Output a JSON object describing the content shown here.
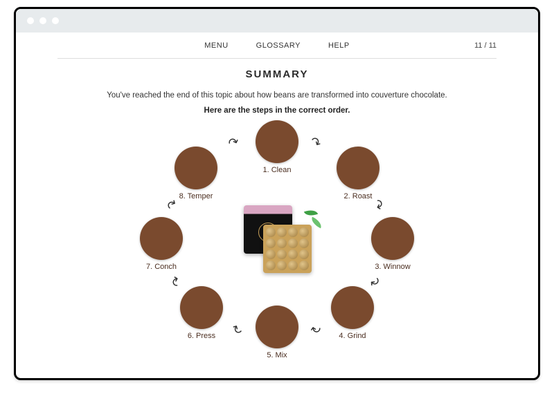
{
  "nav": {
    "menu": "MENU",
    "glossary": "GLOSSARY",
    "help": "HELP"
  },
  "page_counter": "11 / 11",
  "title": "SUMMARY",
  "intro": "You've reached the end of this topic about how beans are transformed into couverture chocolate.",
  "subheading": "Here are the steps in the correct order.",
  "steps": [
    {
      "label": "1. Clean"
    },
    {
      "label": "2. Roast"
    },
    {
      "label": "3. Winnow"
    },
    {
      "label": "4. Grind"
    },
    {
      "label": "5. Mix"
    },
    {
      "label": "6. Press"
    },
    {
      "label": "7. Conch"
    },
    {
      "label": "8. Temper"
    }
  ]
}
